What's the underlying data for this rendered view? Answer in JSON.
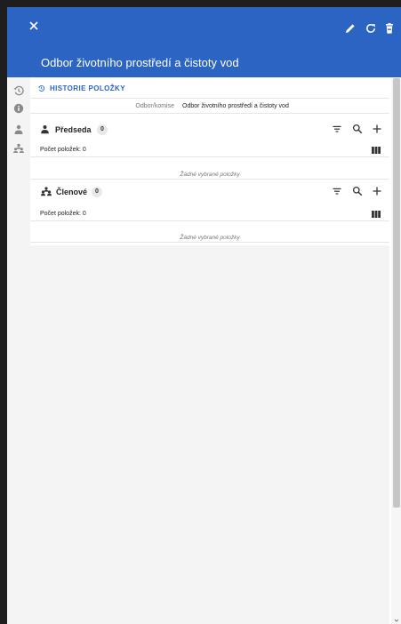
{
  "header": {
    "title": "Odbor životního prostředí a čistoty vod"
  },
  "history": {
    "label": "HISTORIE POLOŽKY"
  },
  "field": {
    "label": "Odbor/komise",
    "value": "Odbor životního prostředí a čistoty vod"
  },
  "sections": [
    {
      "title": "Předseda",
      "badge": "0",
      "count_label": "Počet položek: 0",
      "empty_label": "Žádné vybrané položky"
    },
    {
      "title": "Členové",
      "badge": "0",
      "count_label": "Počet položek: 0",
      "empty_label": "Žádné vybrané položky"
    }
  ],
  "icons": {
    "header": [
      "close-icon",
      "edit-icon",
      "refresh-icon",
      "delete-icon"
    ],
    "sidebar": [
      "history-icon",
      "info-icon",
      "person-icon",
      "group-icon"
    ],
    "tools": [
      "filter-icon",
      "search-icon",
      "add-icon",
      "columns-icon"
    ]
  },
  "colors": {
    "accent": "#2c64c4",
    "panel_bg": "#f4f4f4",
    "card_bg": "#ffffff"
  }
}
